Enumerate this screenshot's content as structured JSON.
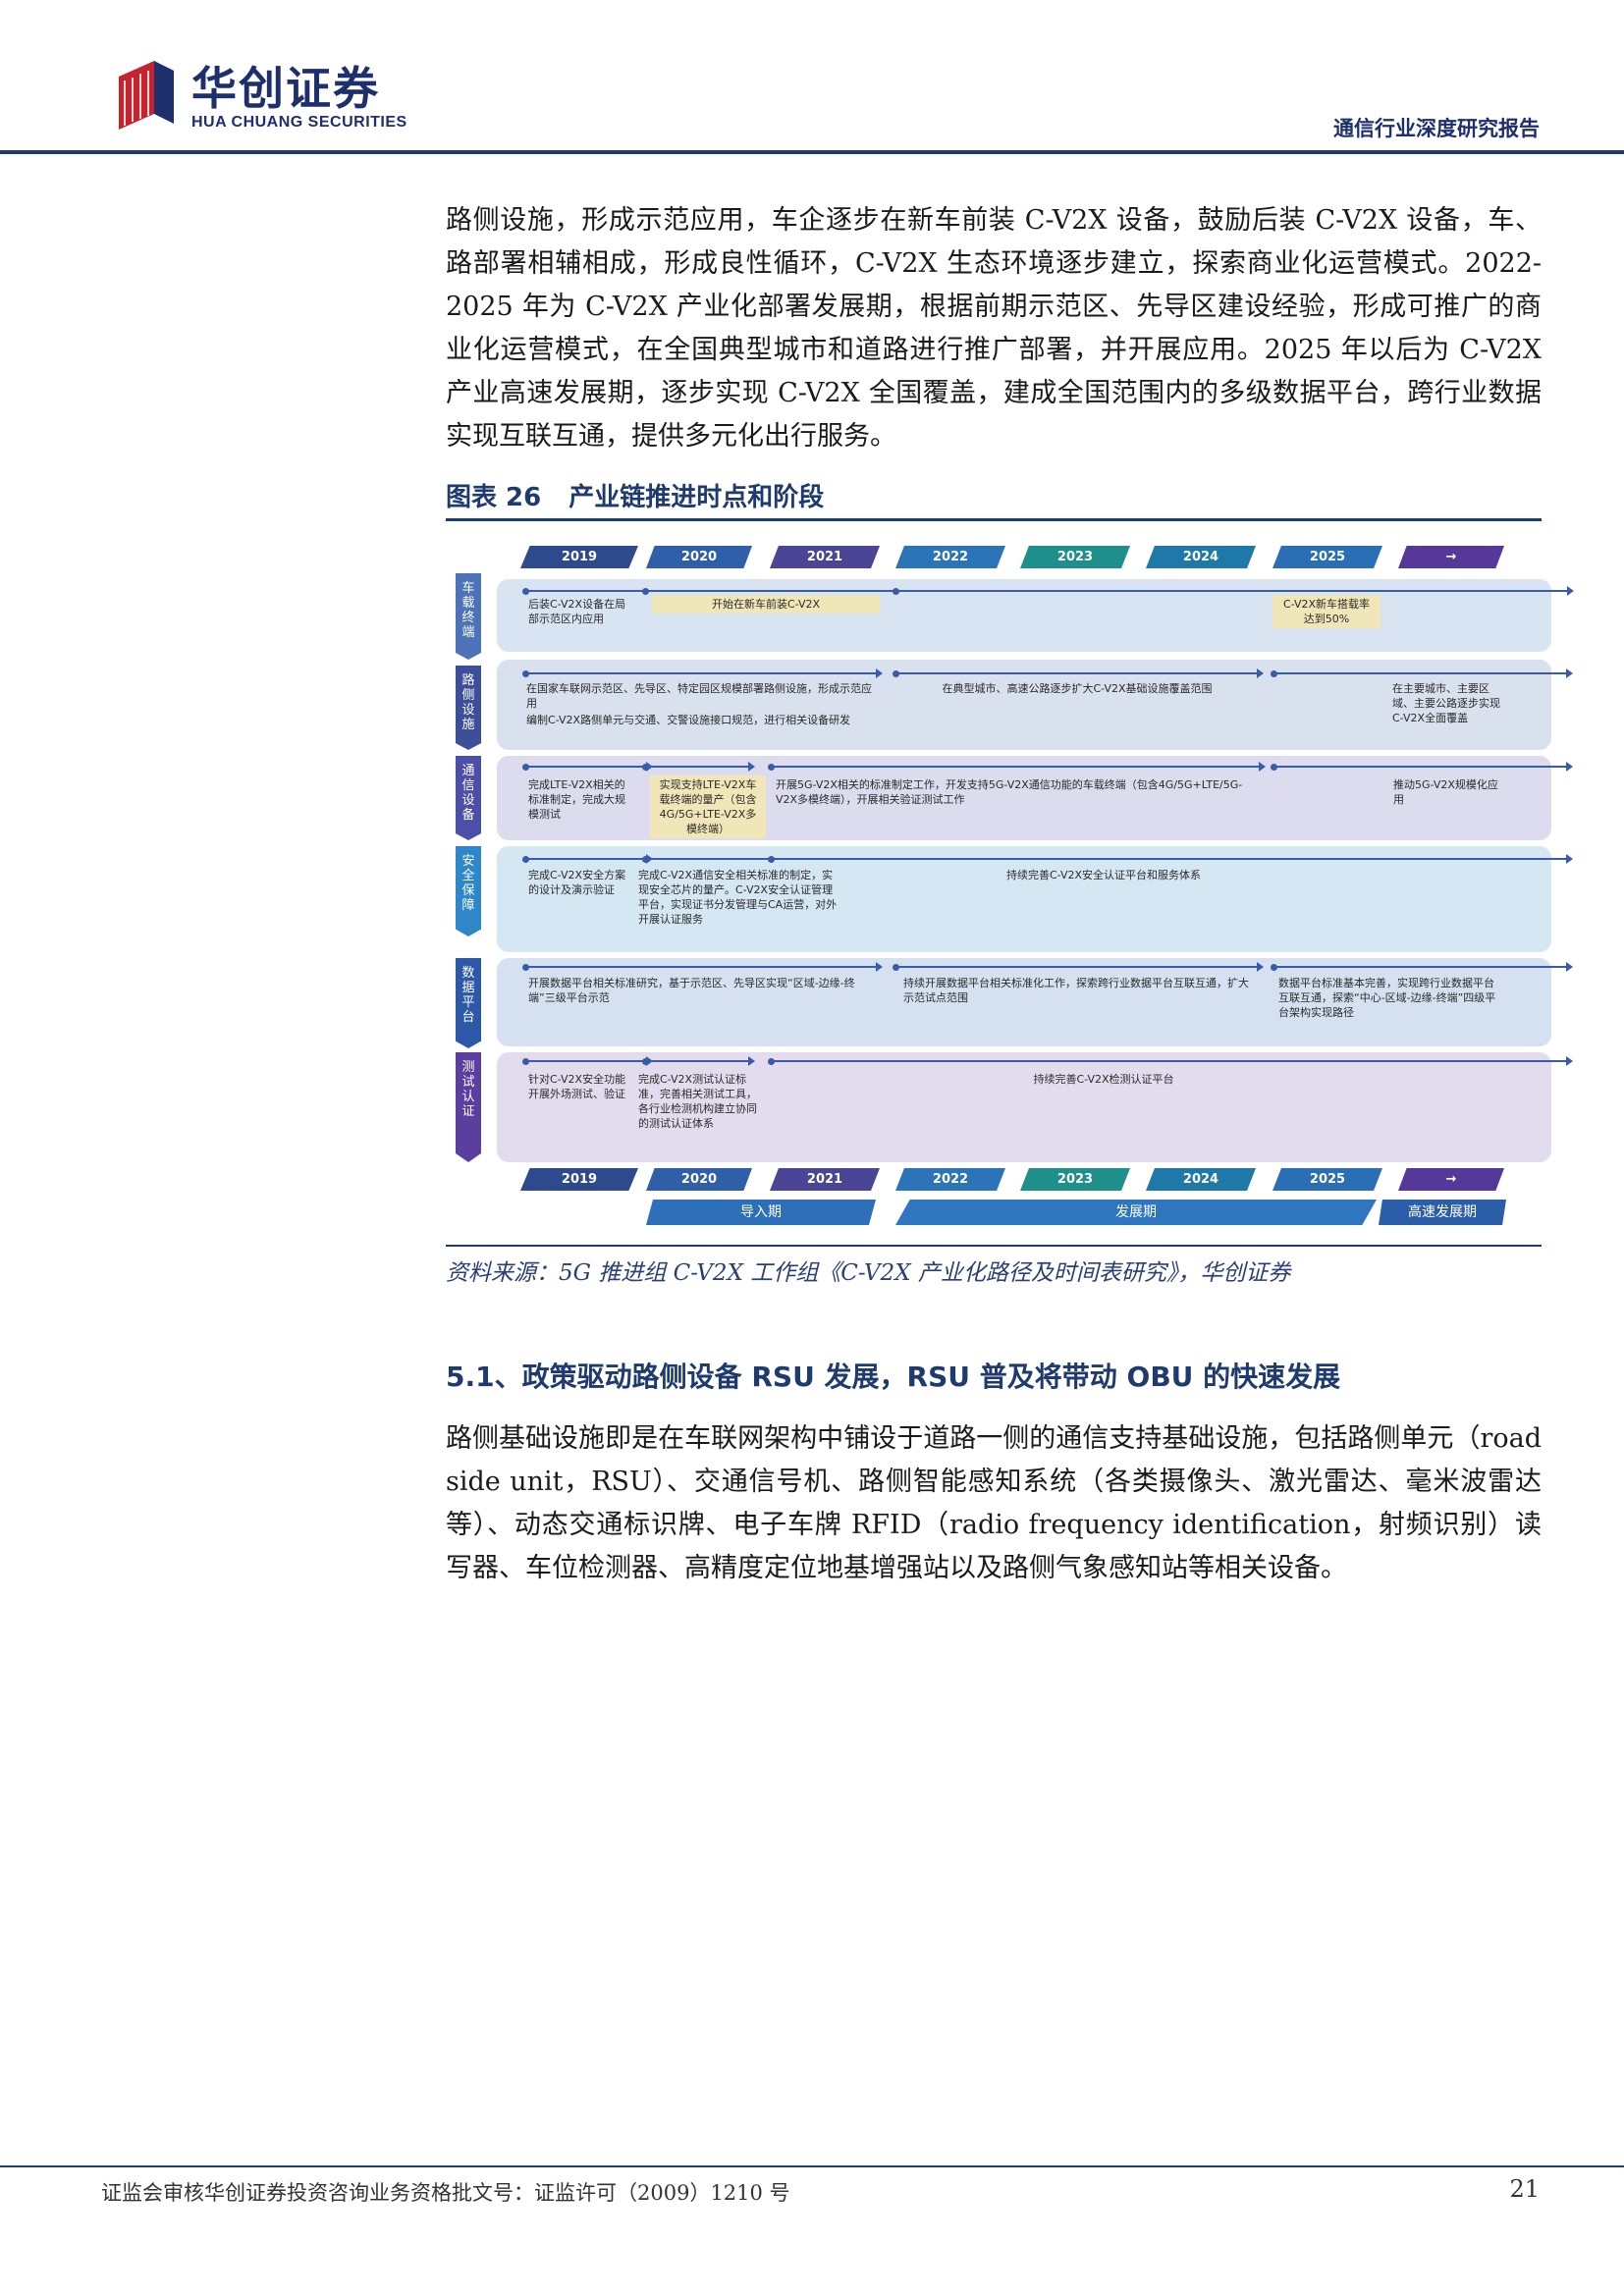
{
  "header": {
    "logo_cn": "华创证券",
    "logo_en": "HUA CHUANG SECURITIES",
    "report_type": "通信行业深度研究报告"
  },
  "paragraphs": {
    "p1": "路侧设施，形成示范应用，车企逐步在新车前装 C-V2X 设备，鼓励后装 C-V2X 设备，车、路部署相辅相成，形成良性循环，C-V2X 生态环境逐步建立，探索商业化运营模式。2022-2025 年为 C-V2X 产业化部署发展期，根据前期示范区、先导区建设经验，形成可推广的商业化运营模式，在全国典型城市和道路进行推广部署，并开展应用。2025 年以后为 C-V2X 产业高速发展期，逐步实现 C-V2X 全国覆盖，建成全国范围内的多级数据平台，跨行业数据实现互联互通，提供多元化出行服务。",
    "p2": "路侧基础设施即是在车联网架构中铺设于道路一侧的通信支持基础设施，包括路侧单元（road side unit，RSU）、交通信号机、路侧智能感知系统（各类摄像头、激光雷达、毫米波雷达等）、动态交通标识牌、电子车牌 RFID（radio frequency identification，射频识别）读写器、车位检测器、高精度定位地基增强站以及路侧气象感知站等相关设备。"
  },
  "figure": {
    "number": "图表 26",
    "title": "产业链推进时点和阶段",
    "years": [
      "2019",
      "2020",
      "2021",
      "2022",
      "2023",
      "2024",
      "2025",
      "→"
    ],
    "rows": [
      {
        "label": [
          "车",
          "载",
          "终",
          "端"
        ],
        "items": [
          "后装C-V2X设备在局部示范区内应用",
          "开始在新车前装C-V2X",
          "C-V2X新车搭载率达到50%"
        ]
      },
      {
        "label": [
          "路",
          "侧",
          "设",
          "施"
        ],
        "items": [
          "在国家车联网示范区、先导区、特定园区规模部署路侧设施，形成示范应用",
          "编制C-V2X路侧单元与交通、交警设施接口规范，进行相关设备研发",
          "在典型城市、高速公路逐步扩大C-V2X基础设施覆盖范围",
          "在主要城市、主要区域、主要公路逐步实现C-V2X全面覆盖"
        ]
      },
      {
        "label": [
          "通",
          "信",
          "设",
          "备"
        ],
        "items": [
          "完成LTE-V2X相关的标准制定，完成大规模测试",
          "实现支持LTE-V2X车载终端的量产（包含4G/5G+LTE-V2X多模终端）",
          "开展5G-V2X相关的标准制定工作，开发支持5G-V2X通信功能的车载终端（包含4G/5G+LTE/5G-V2X多模终端），开展相关验证测试工作",
          "推动5G-V2X规模化应用"
        ]
      },
      {
        "label": [
          "安",
          "全",
          "保",
          "障"
        ],
        "items": [
          "完成C-V2X安全方案的设计及演示验证",
          "完成C-V2X通信安全相关标准的制定，实现安全芯片的量产。C-V2X安全认证管理平台，实现证书分发管理与CA运营，对外开展认证服务",
          "持续完善C-V2X安全认证平台和服务体系"
        ]
      },
      {
        "label": [
          "数",
          "据",
          "平",
          "台"
        ],
        "items": [
          "开展数据平台相关标准研究，基于示范区、先导区实现“区域-边缘-终端”三级平台示范",
          "持续开展数据平台相关标准化工作，探索跨行业数据平台互联互通，扩大示范试点范围",
          "数据平台标准基本完善，实现跨行业数据平台互联互通，探索“中心-区域-边缘-终端”四级平台架构实现路径"
        ]
      },
      {
        "label": [
          "测",
          "试",
          "认",
          "证"
        ],
        "items": [
          "针对C-V2X安全功能开展外场测试、验证",
          "完成C-V2X测试认证标准，完善相关测试工具，各行业检测机构建立协同的测试认证体系",
          "持续完善C-V2X检测认证平台"
        ]
      }
    ],
    "phases": [
      "导入期",
      "发展期",
      "高速发展期"
    ],
    "source": "资料来源：5G 推进组 C-V2X 工作组《C-V2X 产业化路径及时间表研究》，华创证券"
  },
  "section": {
    "title": "5.1、政策驱动路侧设备 RSU 发展，RSU 普及将带动 OBU 的快速发展"
  },
  "footer": {
    "license": "证监会审核华创证券投资咨询业务资格批文号：证监许可（2009）1210 号",
    "page": "21"
  }
}
